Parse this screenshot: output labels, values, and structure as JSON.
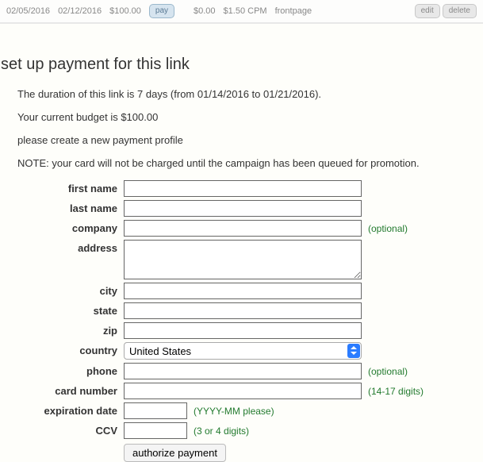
{
  "topbar": {
    "date_start": "02/05/2016",
    "date_end": "02/12/2016",
    "amount": "$100.00",
    "pay_label": "pay",
    "spent": "$0.00",
    "rate": "$1.50 CPM",
    "placement": "frontpage",
    "edit_label": "edit",
    "delete_label": "delete"
  },
  "title": "set up payment for this link",
  "info": {
    "duration": "The duration of this link is 7 days (from 01/14/2016 to 01/21/2016).",
    "budget": "Your current budget is $100.00",
    "profile_prompt": "please create a new payment profile",
    "note": "NOTE: your card will not be charged until the campaign has been queued for promotion."
  },
  "form": {
    "first_name": {
      "label": "first name"
    },
    "last_name": {
      "label": "last name"
    },
    "company": {
      "label": "company",
      "hint": "(optional)"
    },
    "address": {
      "label": "address"
    },
    "city": {
      "label": "city"
    },
    "state": {
      "label": "state"
    },
    "zip": {
      "label": "zip"
    },
    "country": {
      "label": "country",
      "selected": "United States"
    },
    "phone": {
      "label": "phone",
      "hint": "(optional)"
    },
    "card_number": {
      "label": "card number",
      "hint": "(14-17 digits)"
    },
    "expiration": {
      "label": "expiration date",
      "hint": "(YYYY-MM please)"
    },
    "ccv": {
      "label": "CCV",
      "hint": "(3 or 4 digits)"
    },
    "submit": "authorize payment"
  }
}
